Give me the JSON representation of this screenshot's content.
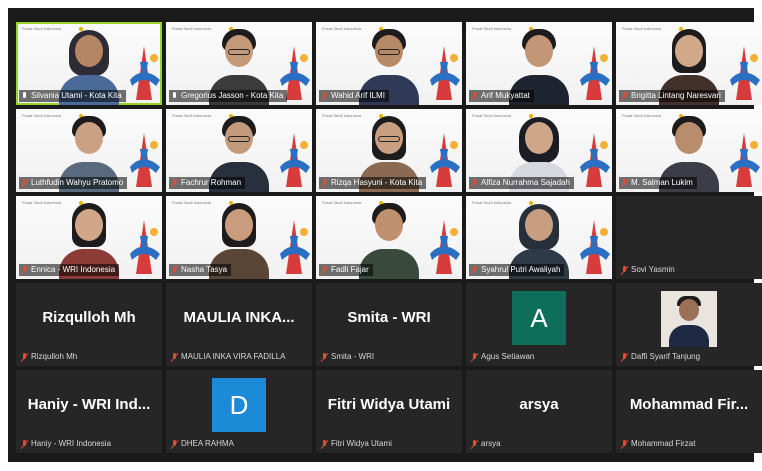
{
  "meeting": {
    "background_brand": "Pusat Studi Indonesia",
    "participants": [
      {
        "type": "video",
        "name": "Silvania Utami - Kota Kita",
        "mic": "on",
        "active": true,
        "skin": "#b58663",
        "hair": "hijab",
        "headwear_color": "#2d2b33",
        "shirt": "#4a6a9a"
      },
      {
        "type": "video",
        "name": "Gregorius Jasson - Kota Kita",
        "mic": "on",
        "skin": "#c59a78",
        "hair": "short",
        "glasses": true,
        "shirt": "#3b3b3b"
      },
      {
        "type": "video",
        "name": "Wahid Arif ILMI",
        "mic": "muted",
        "skin": "#b78a67",
        "hair": "short",
        "glasses": true,
        "shirt": "#2f3b56"
      },
      {
        "type": "video",
        "name": "Arif Mukyattat",
        "mic": "muted",
        "skin": "#c29676",
        "hair": "short",
        "shirt": "#1f2530"
      },
      {
        "type": "video",
        "name": "Brigitta Lintang Naresvari",
        "mic": "muted",
        "skin": "#d2a88a",
        "hair": "long",
        "shirt": "#44302a"
      },
      {
        "type": "video",
        "name": "Luthfudin Wahyu Pratomo",
        "mic": "muted",
        "skin": "#caa182",
        "hair": "short",
        "shirt": "#5a6a7e"
      },
      {
        "type": "video",
        "name": "Fachrur Rohman",
        "mic": "muted",
        "skin": "#c49a7c",
        "hair": "short",
        "glasses": true,
        "shirt": "#28303d"
      },
      {
        "type": "video",
        "name": "Rizqa Hasyuni - Kota Kita",
        "mic": "muted",
        "skin": "#c89f81",
        "hair": "long",
        "glasses": true,
        "shirt": "#8a6a52"
      },
      {
        "type": "video",
        "name": "Alfiza Nurrahma Sajadah",
        "mic": "muted",
        "skin": "#d0a689",
        "hair": "hijab",
        "headwear_color": "#1c1c24",
        "shirt": "#d8d8e0"
      },
      {
        "type": "video",
        "name": "M. Salman Lukim",
        "mic": "muted",
        "skin": "#b98c6c",
        "hair": "short",
        "shirt": "#3c3d46"
      },
      {
        "type": "video",
        "name": "Ennica - WRI Indonesia",
        "mic": "muted",
        "skin": "#d2a688",
        "hair": "long",
        "shirt": "#8c3b36"
      },
      {
        "type": "video",
        "name": "Nasha Tasya",
        "mic": "muted",
        "skin": "#c89c7c",
        "hair": "long",
        "shirt": "#5a4636"
      },
      {
        "type": "video",
        "name": "Fadli Fajar",
        "mic": "muted",
        "skin": "#c0916f",
        "hair": "short",
        "shirt": "#394a3c"
      },
      {
        "type": "video",
        "name": "Syahrul Putri Awaliyah",
        "mic": "muted",
        "skin": "#c99d7f",
        "hair": "hijab",
        "headwear_color": "#27303a",
        "shirt": "#2e3a48"
      },
      {
        "type": "name_only",
        "name": "Sovi Yasmin",
        "mic": "muted",
        "display": ""
      },
      {
        "type": "name_only",
        "name": "Rizqulloh Mh",
        "mic": "muted",
        "display": "Rizqulloh Mh"
      },
      {
        "type": "name_only",
        "name": "MAULIA INKA VIRA FADILLA",
        "mic": "muted",
        "display": "MAULIA INKA..."
      },
      {
        "type": "name_only",
        "name": "Smita - WRI",
        "mic": "muted",
        "display": "Smita - WRI"
      },
      {
        "type": "letter_avatar",
        "name": "Agus Setiawan",
        "mic": "muted",
        "letter": "A",
        "avatar_color": "#0d6e5a"
      },
      {
        "type": "photo_avatar",
        "name": "Daffi Syarif Tanjung",
        "mic": "muted"
      },
      {
        "type": "name_only",
        "name": "Haniy - WRI Indonesia",
        "mic": "muted",
        "display": "Haniy - WRI Ind..."
      },
      {
        "type": "letter_avatar",
        "name": "DHEA RAHMA",
        "mic": "muted",
        "letter": "D",
        "avatar_color": "#1c8ad6"
      },
      {
        "type": "name_only",
        "name": "Fitri Widya Utami",
        "mic": "muted",
        "display": "Fitri Widya Utami"
      },
      {
        "type": "name_only",
        "name": "arsya",
        "mic": "muted",
        "display": "arsya"
      },
      {
        "type": "name_only",
        "name": "Mohammad Firzat",
        "mic": "muted",
        "display": "Mohammad Fir..."
      }
    ]
  }
}
